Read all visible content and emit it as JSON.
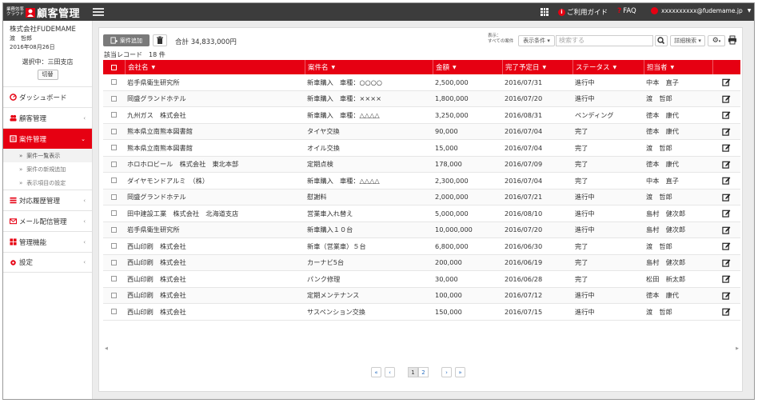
{
  "app": {
    "brand_small": "業務効率クラウド",
    "brand_name": "顧客管理",
    "guide_label": "ご利用ガイド",
    "faq_label": "FAQ",
    "user_email": "xxxxxxxxxx@fudemame.jp"
  },
  "sidebar": {
    "company": "株式会社FUDEMAME",
    "user": "渡　哲郎",
    "date": "2016年08月26日",
    "branch": "選択中：三田支店",
    "switch_label": "切替",
    "items": [
      {
        "label": "ダッシュボード",
        "icon": "dashboard-icon"
      },
      {
        "label": "顧客管理",
        "icon": "customers-icon"
      },
      {
        "label": "案件管理",
        "icon": "deals-icon"
      },
      {
        "label": "対応履歴管理",
        "icon": "history-icon"
      },
      {
        "label": "メール配信管理",
        "icon": "mail-icon"
      },
      {
        "label": "管理機能",
        "icon": "admin-icon"
      },
      {
        "label": "設定",
        "icon": "settings-icon"
      }
    ],
    "subitems": [
      {
        "label": "案件一覧表示"
      },
      {
        "label": "案件の新規追加"
      },
      {
        "label": "表示項目の設定"
      }
    ]
  },
  "toolbar": {
    "add_label": "案件追加",
    "total_label": "合計 34,833,000円",
    "count_label": "該当レコード　18 件",
    "display_label_1": "表示：",
    "display_label_2": "すべての案件",
    "condition_label": "表示条件 ▾",
    "search_placeholder": "検索する",
    "advanced_label": "詳細検索 ▾"
  },
  "table": {
    "headers": [
      "会社名",
      "案件名",
      "金額",
      "完了予定日",
      "ステータス",
      "担当者"
    ],
    "rows": [
      [
        "岩手県衛生研究所",
        "新車購入　車種：○○○○",
        "2,500,000",
        "2016/07/31",
        "進行中",
        "中本　直子"
      ],
      [
        "岡盛グランドホテル",
        "新車購入　車種：××××",
        "1,800,000",
        "2016/07/20",
        "進行中",
        "渡　哲郎"
      ],
      [
        "九州ガス　株式会社",
        "新車購入　車種：△△△△",
        "3,250,000",
        "2016/08/31",
        "ペンディング",
        "徳本　康代"
      ],
      [
        "熊本県立南熊本図書館",
        "タイヤ交換",
        "90,000",
        "2016/07/04",
        "完了",
        "徳本　康代"
      ],
      [
        "熊本県立南熊本図書館",
        "オイル交換",
        "15,000",
        "2016/07/04",
        "完了",
        "渡　哲郎"
      ],
      [
        "ホロホロビール　株式会社　東北本部",
        "定期点検",
        "178,000",
        "2016/07/09",
        "完了",
        "徳本　康代"
      ],
      [
        "ダイヤモンドアルミ　（株）",
        "新車購入　車種：△△△△",
        "2,300,000",
        "2016/07/04",
        "完了",
        "中本　直子"
      ],
      [
        "岡盛グランドホテル",
        "慰謝料",
        "2,000,000",
        "2016/07/21",
        "進行中",
        "渡　哲郎"
      ],
      [
        "田中建設工業　株式会社　北海道支店",
        "営業車入れ替え",
        "5,000,000",
        "2016/08/10",
        "進行中",
        "島村　健次郎"
      ],
      [
        "岩手県衛生研究所",
        "新車購入１０台",
        "10,000,000",
        "2016/07/20",
        "進行中",
        "島村　健次郎"
      ],
      [
        "西山印刷　株式会社",
        "新車（営業車）５台",
        "6,800,000",
        "2016/06/30",
        "完了",
        "渡　哲郎"
      ],
      [
        "西山印刷　株式会社",
        "カーナビ5台",
        "200,000",
        "2016/06/19",
        "完了",
        "島村　健次郎"
      ],
      [
        "西山印刷　株式会社",
        "パンク修理",
        "30,000",
        "2016/06/28",
        "完了",
        "松田　新太郎"
      ],
      [
        "西山印刷　株式会社",
        "定期メンテナンス",
        "100,000",
        "2016/07/12",
        "進行中",
        "徳本　康代"
      ],
      [
        "西山印刷　株式会社",
        "サスペンション交換",
        "150,000",
        "2016/07/15",
        "進行中",
        "渡　哲郎"
      ]
    ]
  },
  "pager": {
    "first": "«",
    "prev": "‹",
    "pages": [
      "1",
      "2"
    ],
    "next": "›",
    "last": "»"
  },
  "colors": {
    "accent": "#e60012",
    "topbar": "#3c3c3c"
  }
}
